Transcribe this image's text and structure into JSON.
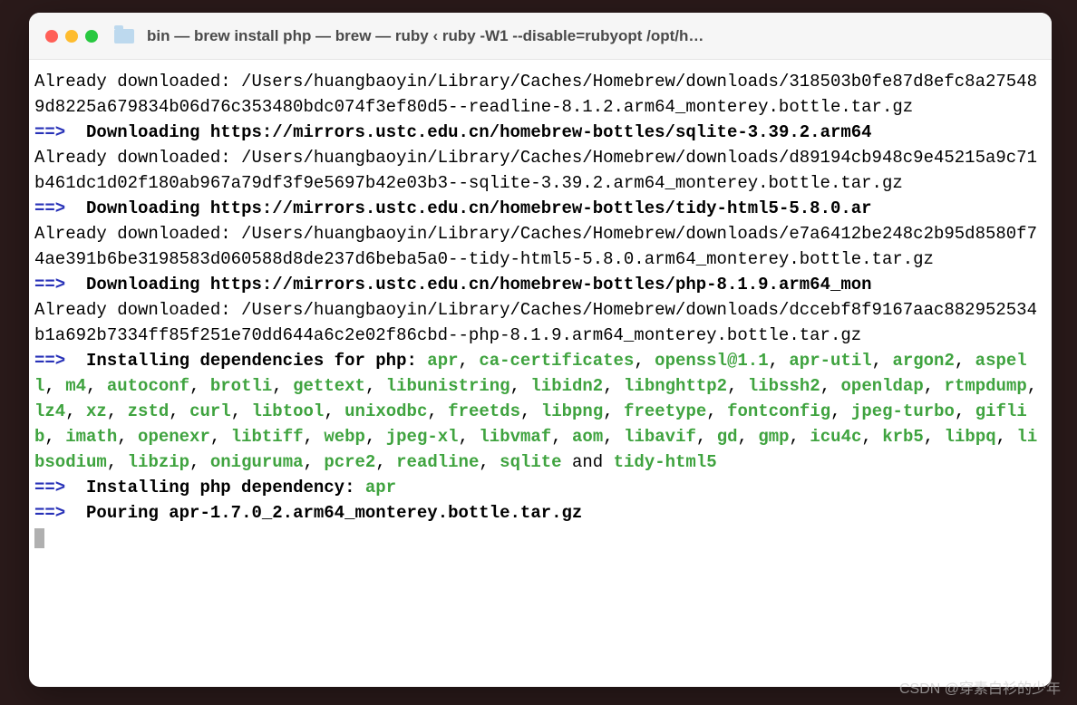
{
  "titlebar": {
    "title": "bin — brew install php — brew — ruby ‹ ruby -W1 --disable=rubyopt /opt/h…"
  },
  "dl": {
    "already": "Already downloaded: ",
    "arrow": "==>",
    "downloading_prefix": "Downloading ",
    "readline_cache": "/Users/huangbaoyin/Library/Caches/Homebrew/downloads/318503b0fe87d8efc8a275489d8225a679834b06d76c353480bdc074f3ef80d5--readline-8.1.2.arm64_monterey.bottle.tar.gz",
    "sqlite_url": "https://mirrors.ustc.edu.cn/homebrew-bottles/sqlite-3.39.2.arm64",
    "sqlite_cache": "/Users/huangbaoyin/Library/Caches/Homebrew/downloads/d89194cb948c9e45215a9c71b461dc1d02f180ab967a79df3f9e5697b42e03b3--sqlite-3.39.2.arm64_monterey.bottle.tar.gz",
    "tidy_url": "https://mirrors.ustc.edu.cn/homebrew-bottles/tidy-html5-5.8.0.ar",
    "tidy_cache": "/Users/huangbaoyin/Library/Caches/Homebrew/downloads/e7a6412be248c2b95d8580f74ae391b6be3198583d060588d8de237d6beba5a0--tidy-html5-5.8.0.arm64_monterey.bottle.tar.gz",
    "php_url": "https://mirrors.ustc.edu.cn/homebrew-bottles/php-8.1.9.arm64_mon",
    "php_cache": "/Users/huangbaoyin/Library/Caches/Homebrew/downloads/dccebf8f9167aac882952534b1a692b7334ff85f251e70dd644a6c2e02f86cbd--php-8.1.9.arm64_monterey.bottle.tar.gz"
  },
  "deps": {
    "heading": "Installing dependencies for php: ",
    "sep": ", ",
    "and": " and ",
    "list": [
      "apr",
      "ca-certificates",
      "openssl@1.1",
      "apr-util",
      "argon2",
      "aspell",
      "m4",
      "autoconf",
      "brotli",
      "gettext",
      "libunistring",
      "libidn2",
      "libnghttp2",
      "libssh2",
      "openldap",
      "rtmpdump",
      "lz4",
      "xz",
      "zstd",
      "curl",
      "libtool",
      "unixodbc",
      "freetds",
      "libpng",
      "freetype",
      "fontconfig",
      "jpeg-turbo",
      "giflib",
      "imath",
      "openexr",
      "libtiff",
      "webp",
      "jpeg-xl",
      "libvmaf",
      "aom",
      "libavif",
      "gd",
      "gmp",
      "icu4c",
      "krb5",
      "libpq",
      "libsodium",
      "libzip",
      "oniguruma",
      "pcre2",
      "readline",
      "sqlite",
      "tidy-html5"
    ]
  },
  "install_one": {
    "heading": "Installing php dependency: ",
    "name": "apr"
  },
  "pouring": {
    "heading": "Pouring ",
    "file": "apr-1.7.0_2.arm64_monterey.bottle.tar.gz"
  },
  "watermark": "CSDN @穿素白衫的少年"
}
